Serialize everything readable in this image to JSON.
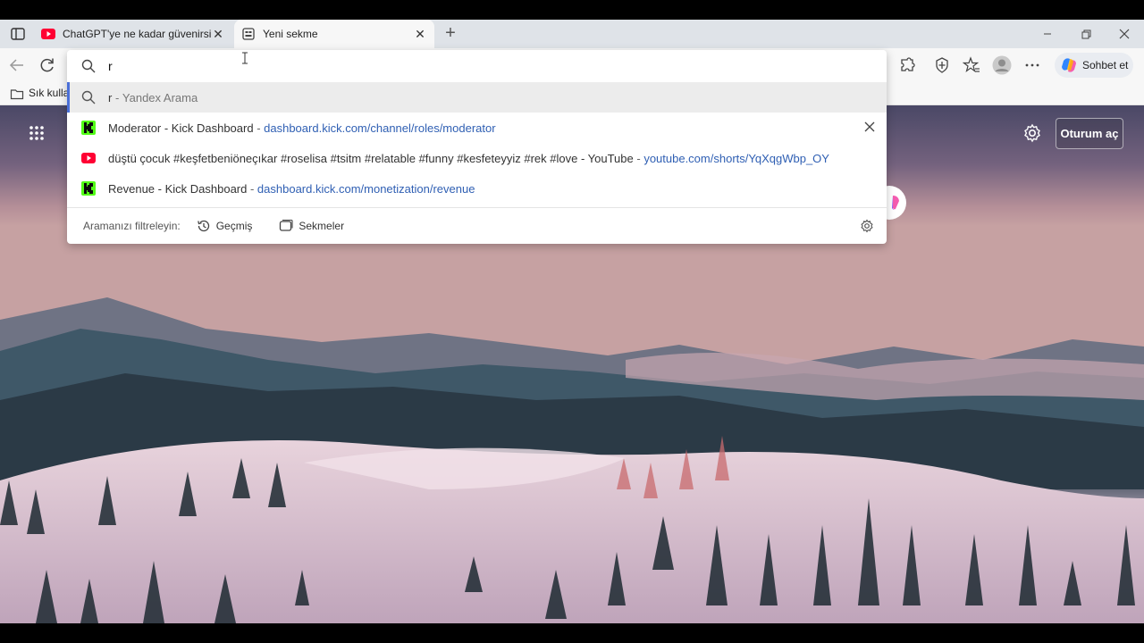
{
  "browser": {
    "tabs": [
      {
        "title": "ChatGPT'ye ne kadar güvenirsin?",
        "favicon": "youtube-icon",
        "active": false
      },
      {
        "title": "Yeni sekme",
        "favicon": "newtab-icon",
        "active": true
      }
    ],
    "toolbar": {
      "chat_label": "Sohbet et"
    },
    "favorites_bar": {
      "label": "Sık kullan"
    }
  },
  "omnibox": {
    "value": "r",
    "suggestions": [
      {
        "type": "search",
        "query": "r",
        "provider": "Yandex Arama",
        "separator": " - "
      },
      {
        "type": "history",
        "favicon": "kick-icon",
        "title": "Moderator - Kick Dashboard",
        "url": "dashboard.kick.com/channel/roles/moderator"
      },
      {
        "type": "history",
        "favicon": "youtube-icon",
        "title": "düştü çocuk #keşfetbeniöneçıkar #roselisa #tsitm #relatable #funny #kesfeteyyiz #rek #love - YouTube",
        "url": "youtube.com/shorts/YqXqgWbp_OY"
      },
      {
        "type": "history",
        "favicon": "kick-icon",
        "title": "Revenue - Kick Dashboard",
        "url": "dashboard.kick.com/monetization/revenue"
      }
    ],
    "filter": {
      "label": "Aramanızı filtreleyin:",
      "history_label": "Geçmiş",
      "tabs_label": "Sekmeler"
    }
  },
  "newtab": {
    "signin_label": "Oturum aç"
  },
  "colors": {
    "accent": "#4a6fd8",
    "link": "#2f5fb3",
    "kick_green": "#53fc18",
    "youtube_red": "#ff0033"
  }
}
